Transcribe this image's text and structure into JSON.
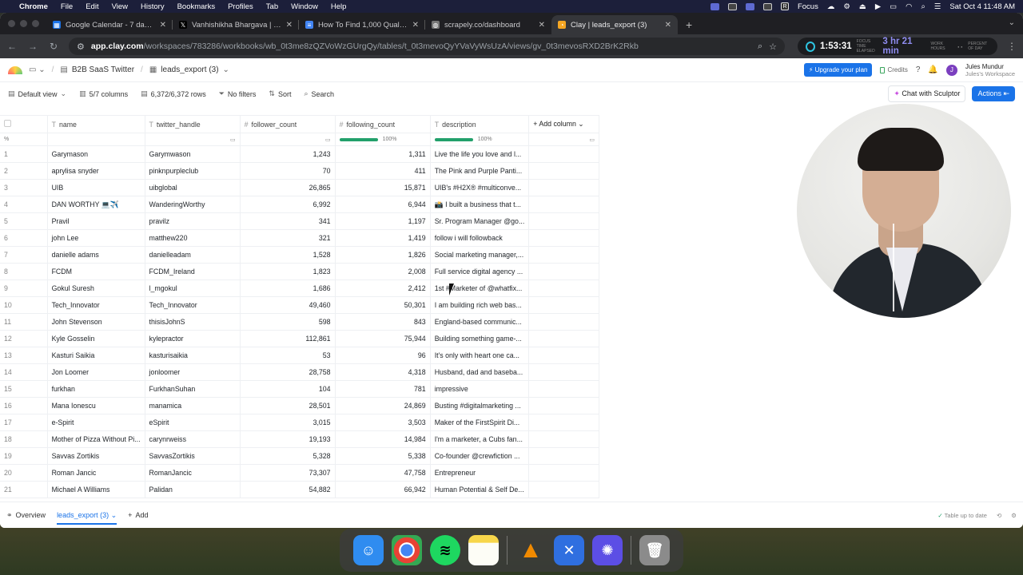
{
  "menubar": {
    "app_name": "Chrome",
    "menus": [
      "File",
      "Edit",
      "View",
      "History",
      "Bookmarks",
      "Profiles",
      "Tab",
      "Window",
      "Help"
    ],
    "focus_label": "Focus",
    "datetime": "Sat Oct 4  11:48 AM"
  },
  "browser": {
    "tabs": [
      {
        "title": "Google Calendar - 7 days, st",
        "icon": "calendar-icon",
        "color": "#1a73e8"
      },
      {
        "title": "Vanhishikha Bhargava | B2B",
        "icon": "x-icon",
        "color": "#000000"
      },
      {
        "title": "How To Find 1,000 Qualified",
        "icon": "doc-icon",
        "color": "#4285f4"
      },
      {
        "title": "scrapely.co/dashboard",
        "icon": "globe-icon",
        "color": "#777777"
      },
      {
        "title": "Clay | leads_export (3)",
        "icon": "clay-icon",
        "color": "#f5a623"
      }
    ],
    "url_host": "app.clay.com",
    "url_path": "/workspaces/783286/workbooks/wb_0t3me8zQZVoWzGUrgQy/tables/t_0t3mevoQyYVaVyWsUzA/views/gv_0t3mevosRXD2BrK2Rkb",
    "timer_elapsed": "1:53:31",
    "timer_elapsed_caption": "FOCUS TIME ELAPSED",
    "timer_remaining": "3 hr 21 min",
    "timer_remaining_caption": "WORK HOURS",
    "timer_day_caption": "PERCENT OF DAY"
  },
  "app": {
    "workbook": "B2B SaaS Twitter",
    "table": "leads_export (3)",
    "upgrade_label": "Upgrade your plan",
    "credits_label": "Credits",
    "user_name": "Jules Mundur",
    "user_workspace": "Jules's Workspace",
    "avatar_initial": "J"
  },
  "viewbar": {
    "view": "Default view",
    "columns": "5/7 columns",
    "rows": "6,372/6,372 rows",
    "filters": "No filters",
    "sort": "Sort",
    "search": "Search",
    "sculptor": "Chat with Sculptor",
    "actions": "Actions"
  },
  "table": {
    "columns": [
      "name",
      "twitter_handle",
      "follower_count",
      "following_count",
      "description"
    ],
    "add_column": "Add column",
    "pct_label": "%",
    "fill_follower": "100%",
    "fill_following": "100%",
    "rows": [
      [
        "1",
        "Garymason",
        "Garymwason",
        "1,243",
        "1,311",
        "Live the life you love and l..."
      ],
      [
        "2",
        "aprylisa snyder",
        "pinknpurpleclub",
        "70",
        "411",
        "The Pink and Purple Panti..."
      ],
      [
        "3",
        "UIB",
        "uibglobal",
        "26,865",
        "15,871",
        "UIB's #H2X® #multiconve..."
      ],
      [
        "4",
        "DAN WORTHY 💻✈️",
        "WanderingWorthy",
        "6,992",
        "6,944",
        "📸 I built a business that t..."
      ],
      [
        "5",
        "Pravil",
        "pravilz",
        "341",
        "1,197",
        "Sr. Program Manager @go..."
      ],
      [
        "6",
        "john Lee",
        "matthew220",
        "321",
        "1,419",
        "follow i will followback"
      ],
      [
        "7",
        "danielle adams",
        "danielleadam",
        "1,528",
        "1,826",
        "Social marketing manager,..."
      ],
      [
        "8",
        "FCDM",
        "FCDM_Ireland",
        "1,823",
        "2,008",
        "Full service digital agency ..."
      ],
      [
        "9",
        "Gokul Suresh",
        "l_mgokul",
        "1,686",
        "2,412",
        "1st #Marketer of @whatfix..."
      ],
      [
        "10",
        "Tech_Innovator",
        "Tech_Innovator",
        "49,460",
        "50,301",
        "I am building rich web bas..."
      ],
      [
        "11",
        "John Stevenson",
        "thisisJohnS",
        "598",
        "843",
        "England-based communic..."
      ],
      [
        "12",
        "Kyle Gosselin",
        "kylepractor",
        "112,861",
        "75,944",
        "Building something game-..."
      ],
      [
        "13",
        "Kasturi Saikia",
        "kasturisaikia",
        "53",
        "96",
        "It's only with heart one ca..."
      ],
      [
        "14",
        "Jon Loomer",
        "jonloomer",
        "28,758",
        "4,318",
        "Husband, dad and baseba..."
      ],
      [
        "15",
        "furkhan",
        "FurkhanSuhan",
        "104",
        "781",
        "impressive"
      ],
      [
        "16",
        "Mana Ionescu",
        "manamica",
        "28,501",
        "24,869",
        "Busting #digitalmarketing ..."
      ],
      [
        "17",
        "e-Spirit",
        "eSpirit",
        "3,015",
        "3,503",
        "Maker of the FirstSpirit Di..."
      ],
      [
        "18",
        "Mother of Pizza Without Pi...",
        "carynrweiss",
        "19,193",
        "14,984",
        "I'm a marketer, a Cubs fan..."
      ],
      [
        "19",
        "Savvas Zortikis",
        "SavvasZortikis",
        "5,328",
        "5,338",
        "Co-founder @crewfiction ..."
      ],
      [
        "20",
        "Roman Jancic",
        "RomanJancic",
        "73,307",
        "47,758",
        "Entrepreneur"
      ],
      [
        "21",
        "Michael A Williams",
        "Palidan",
        "54,882",
        "66,942",
        "Human Potential & Self De..."
      ]
    ]
  },
  "bottombar": {
    "overview": "Overview",
    "active_tab": "leads_export (3)",
    "add": "Add",
    "status": "Table up to date"
  },
  "dock": {
    "apps": [
      {
        "name": "Finder",
        "icon": "finder-icon",
        "color": "#2f8cf0"
      },
      {
        "name": "Chrome",
        "icon": "chrome-icon",
        "color": "#ffffff"
      },
      {
        "name": "Spotify",
        "icon": "spotify-icon",
        "color": "#1ed760"
      },
      {
        "name": "Notes",
        "icon": "notes-icon",
        "color": "#f7d64a"
      },
      {
        "name": "VLC",
        "icon": "vlc-icon",
        "color": "#f08a00"
      },
      {
        "name": "Linear",
        "icon": "linear-icon",
        "color": "#2f6fe0"
      },
      {
        "name": "Screen Recorder",
        "icon": "recorder-icon",
        "color": "#5c4ee5"
      },
      {
        "name": "Trash",
        "icon": "trash-icon",
        "color": "#9a9a9a"
      }
    ]
  }
}
